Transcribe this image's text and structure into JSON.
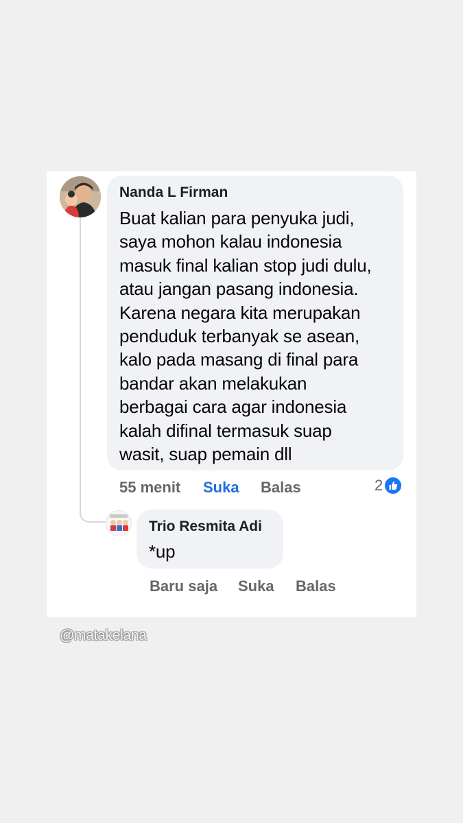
{
  "comment": {
    "author": "Nanda L Firman",
    "avatar": "profile-photo",
    "text": "Buat kalian para penyuka judi,\nsaya mohon kalau indonesia\nmasuk final kalian stop judi dulu,\natau jangan pasang indonesia.\nKarena negara kita merupakan\npenduduk terbanyak se asean,\nkalo pada masang di final para\nbandar akan melakukan\nberbagai cara agar indonesia\nkalah difinal termasuk suap\nwasit, suap pemain dll",
    "time": "55 menit",
    "like_label": "Suka",
    "reply_label": "Balas",
    "reaction_count": "2",
    "reaction_icon": "thumbs-up-icon",
    "like_color": "#216fdb"
  },
  "reply": {
    "author": "Trio Resmita Adi",
    "avatar": "cartoon-avatar",
    "text": "*up",
    "time": "Baru saja",
    "like_label": "Suka",
    "reply_label": "Balas"
  },
  "watermark": "@matakelana"
}
